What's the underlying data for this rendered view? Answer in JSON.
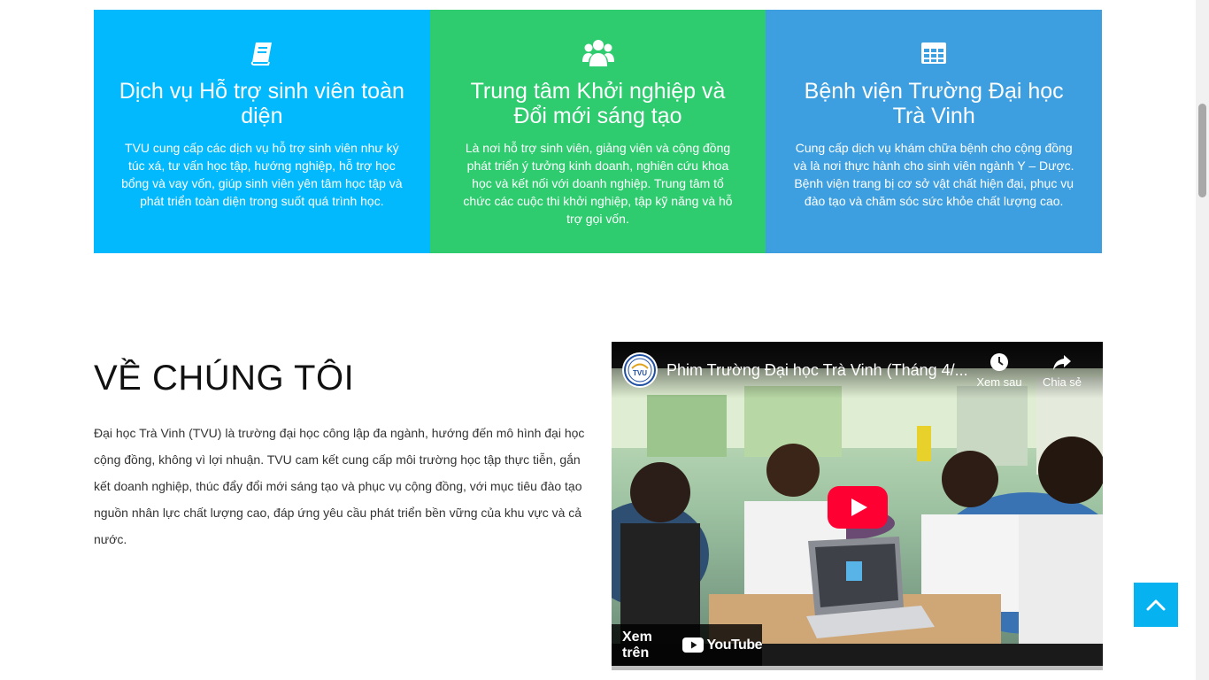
{
  "features": [
    {
      "icon": "book-icon",
      "color": "#03b9fd",
      "title": "Dịch vụ Hỗ trợ sinh viên toàn diện",
      "text": "TVU cung cấp các dịch vụ hỗ trợ sinh viên như ký túc xá, tư vấn học tập, hướng nghiệp, hỗ trợ học bổng và vay vốn, giúp sinh viên yên tâm học tập và phát triển toàn diện trong suốt quá trình học."
    },
    {
      "icon": "users-icon",
      "color": "#2ecc6f",
      "title": "Trung tâm Khởi nghiệp và Đổi mới sáng tạo",
      "text": "Là nơi hỗ trợ sinh viên, giảng viên và cộng đồng phát triển ý tưởng kinh doanh, nghiên cứu khoa học và kết nối với doanh nghiệp. Trung tâm tổ chức các cuộc thi khởi nghiệp, tập kỹ năng và hỗ trợ gọi vốn."
    },
    {
      "icon": "table-icon",
      "color": "#3e9fe0",
      "title": "Bệnh viện Trường Đại học Trà Vinh",
      "text": "Cung cấp dịch vụ khám chữa bệnh cho cộng đồng và là nơi thực hành cho sinh viên ngành Y – Dược. Bệnh viện trang bị cơ sở vật chất hiện đại, phục vụ đào tạo và chăm sóc sức khỏe chất lượng cao."
    }
  ],
  "about": {
    "title": "VỀ CHÚNG TÔI",
    "text": "Đại học Trà Vinh (TVU) là trường đại học công lập đa ngành, hướng đến mô hình đại học cộng đồng, không vì lợi nhuận. TVU cam kết cung cấp môi trường học tập thực tiễn, gắn kết doanh nghiệp, thúc đẩy đổi mới sáng tạo và phục vụ cộng đồng, với mục tiêu đào tạo nguồn nhân lực chất lượng cao, đáp ứng yêu cầu phát triển bền vững của khu vực và cả nước."
  },
  "video": {
    "channel_logo": "TVU",
    "title": "Phim Trường Đại học Trà Vinh (Tháng 4/...",
    "watch_later": "Xem sau",
    "share": "Chia sẻ",
    "watch_on": "Xem trên",
    "youtube": "YouTube"
  },
  "back_to_top_icon": "chevron-up-icon"
}
